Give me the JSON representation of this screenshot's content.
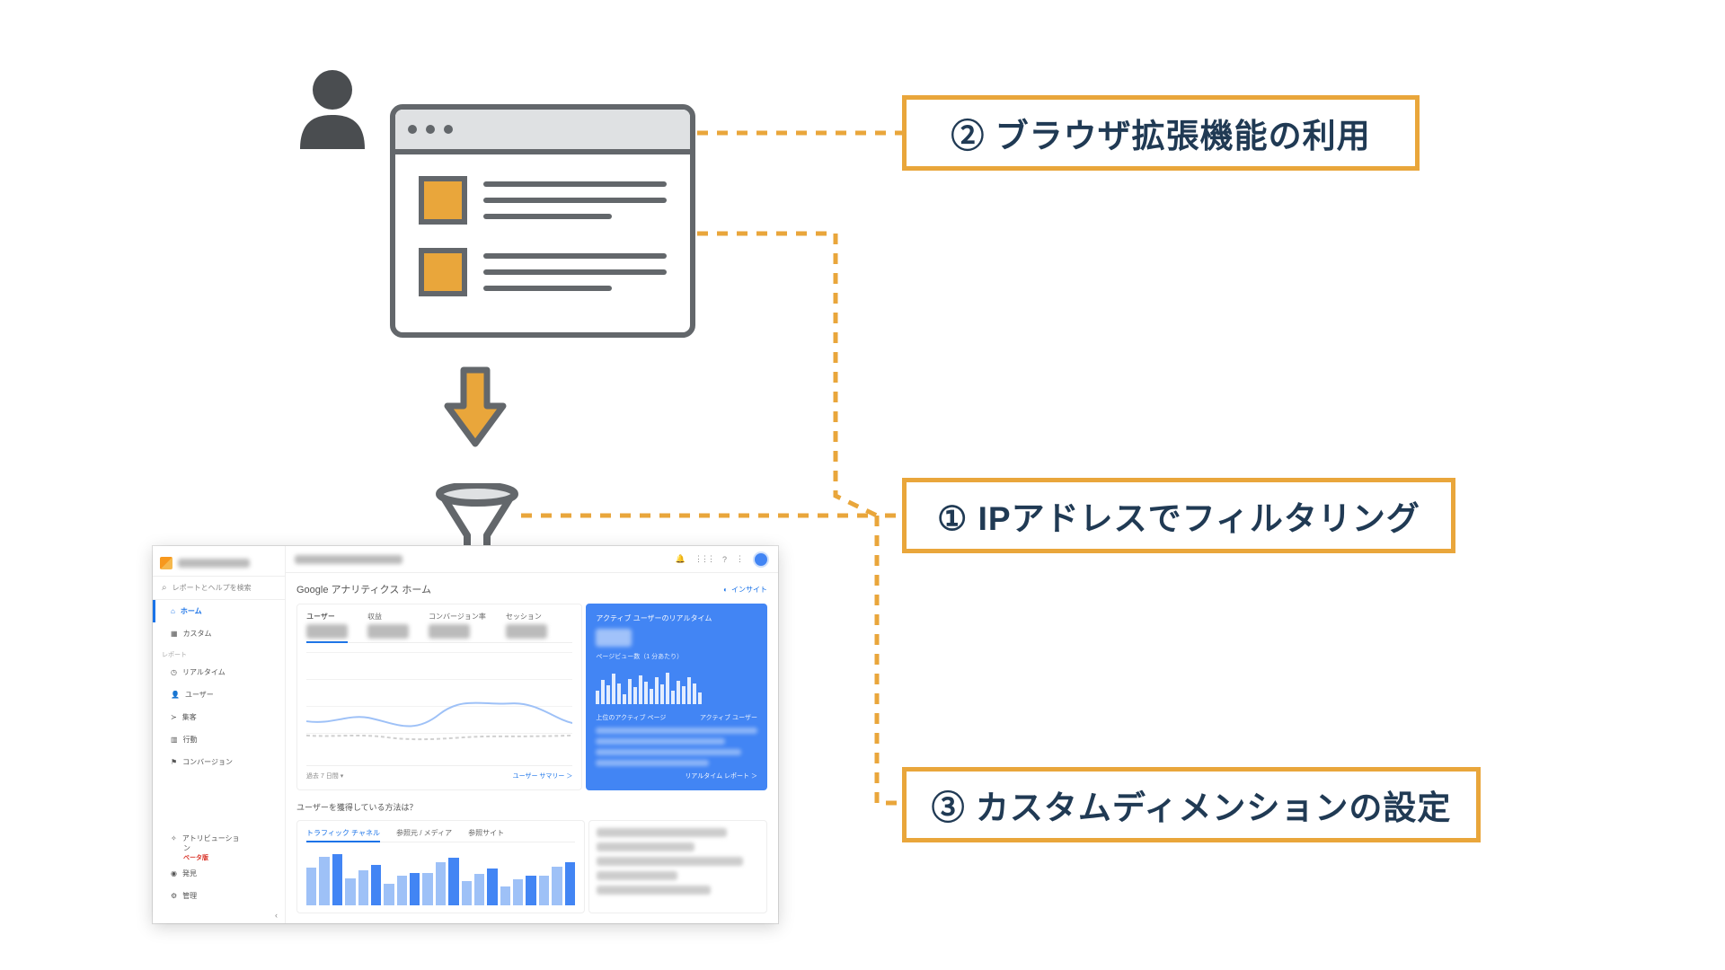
{
  "callouts": {
    "c2": "② ブラウザ拡張機能の利用",
    "c1": "① IPアドレスでフィルタリング",
    "c3": "③ カスタムディメンションの設定"
  },
  "ga": {
    "search_placeholder": "レポートとヘルプを検索",
    "home_title": "Google アナリティクス ホーム",
    "insights_label": "インサイト",
    "sidebar": {
      "home": "ホーム",
      "custom": "カスタム",
      "section": "レポート",
      "realtime": "リアルタイム",
      "user": "ユーザー",
      "acquisition": "集客",
      "behavior": "行動",
      "conversion": "コンバージョン",
      "attribution1": "アトリビューショ",
      "attribution2": "ン",
      "beta": "ベータ版",
      "discover": "発見",
      "admin": "管理"
    },
    "metrics": {
      "users": "ユーザー",
      "revenue": "収益",
      "cvr": "コンバージョン率",
      "sessions": "セッション",
      "range": "過去 7 日間 ▾",
      "summary_link": "ユーザー サマリー ＞"
    },
    "realtime": {
      "title": "アクティブ ユーザーのリアルタイム",
      "sub": "ページビュー数（1 分あたり）",
      "row_head_left": "上位のアクティブ ページ",
      "row_head_right": "アクティブ ユーザー",
      "footer": "リアルタイム レポート ＞"
    },
    "acq": {
      "title": "ユーザーを獲得している方法は？",
      "tab1": "トラフィック チャネル",
      "tab2": "参照元 / メディア",
      "tab3": "参照サイト"
    }
  }
}
